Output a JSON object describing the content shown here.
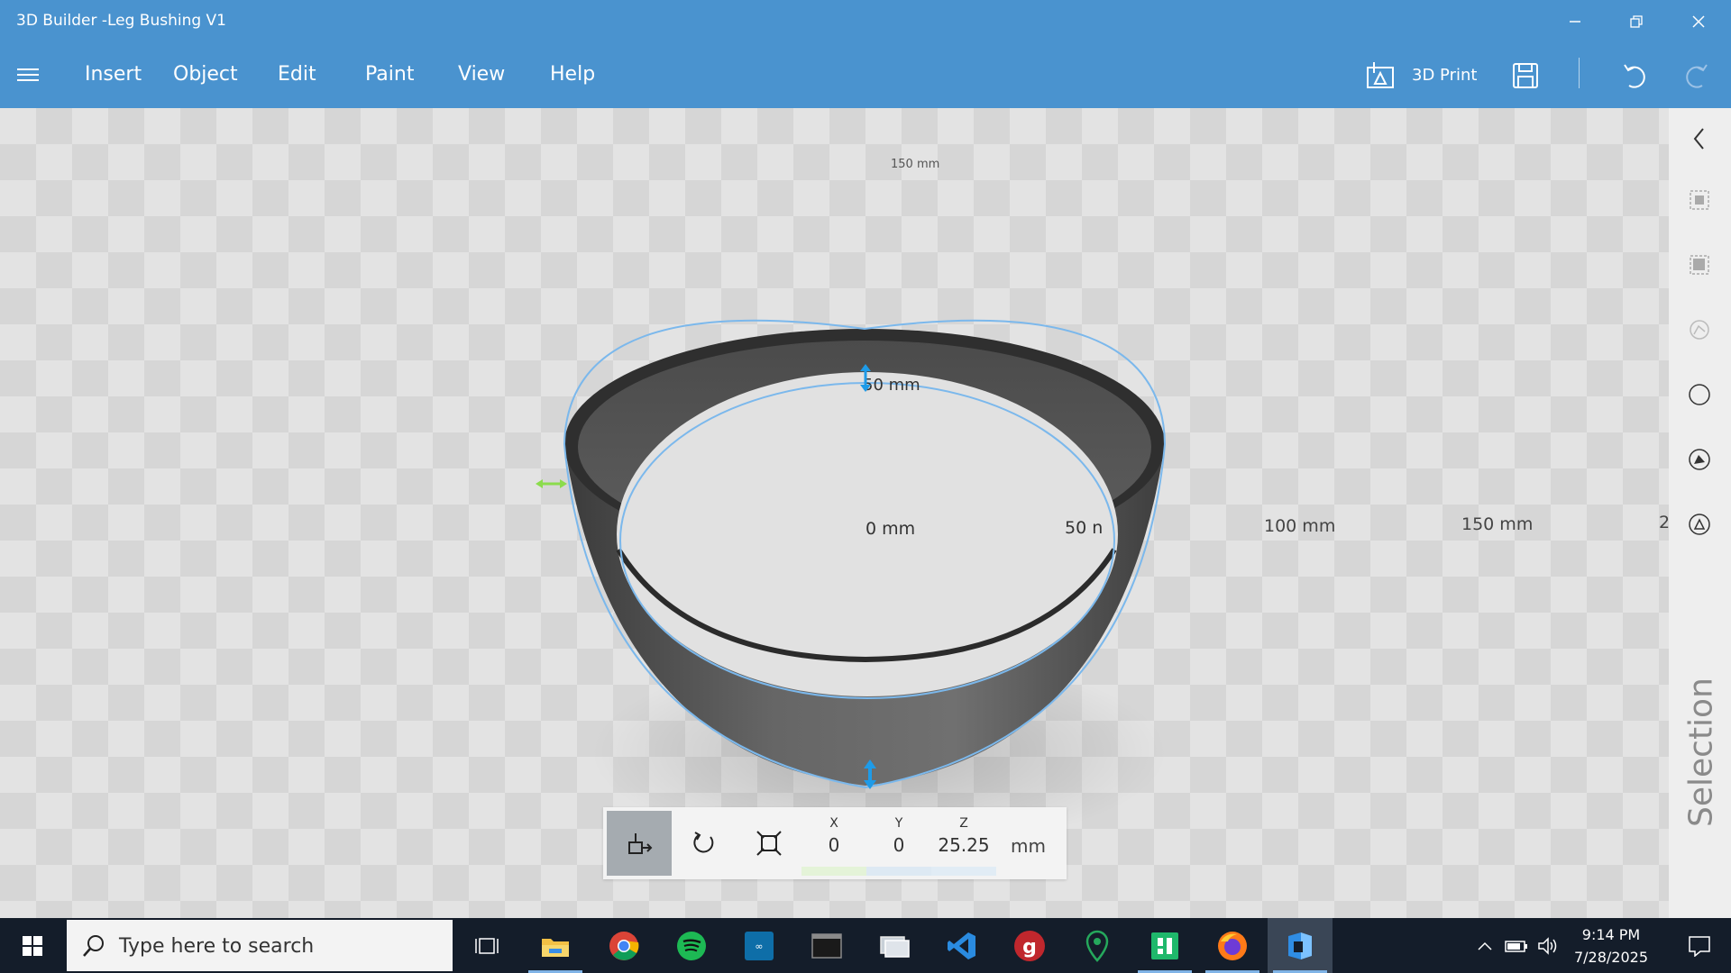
{
  "window": {
    "title": "3D Builder -Leg Bushing V1",
    "controls": [
      "minimize",
      "restore",
      "close"
    ]
  },
  "menu": {
    "items": [
      "Insert",
      "Object",
      "Edit",
      "Paint",
      "View",
      "Help"
    ],
    "print_label": "3D Print"
  },
  "viewport": {
    "object_name": "Leg Bushing V1",
    "grid_labels": {
      "back": "150 mm",
      "inner": "50 mm",
      "origin": "0 mm",
      "x50": "50 n",
      "x100": "100 mm",
      "x150": "150 mm",
      "edge": "2"
    }
  },
  "right_panel": {
    "label": "Selection",
    "icons": [
      "chevron-left-icon",
      "select-objects-icon",
      "select-faces-icon",
      "select-edges-icon",
      "select-circle-icon",
      "select-vertex-icon",
      "select-triangle-icon"
    ]
  },
  "transform": {
    "x_label": "X",
    "x_value": "0",
    "y_label": "Y",
    "y_value": "0",
    "z_label": "Z",
    "z_value": "25.25",
    "unit": "mm"
  },
  "taskbar": {
    "search_placeholder": "Type here to search",
    "time": "9:14 PM",
    "date": "7/28/2025",
    "apps": [
      "task-view",
      "file-explorer",
      "chrome",
      "spotify",
      "arduino",
      "terminal",
      "devices",
      "vscode",
      "git",
      "maps",
      "spreadsheet",
      "firefox",
      "3d-builder"
    ]
  },
  "colors": {
    "accent": "#4a93cf",
    "selection": "#7bb8ec",
    "x_axis": "#8bdc4c",
    "taskbar": "#141d2a"
  }
}
